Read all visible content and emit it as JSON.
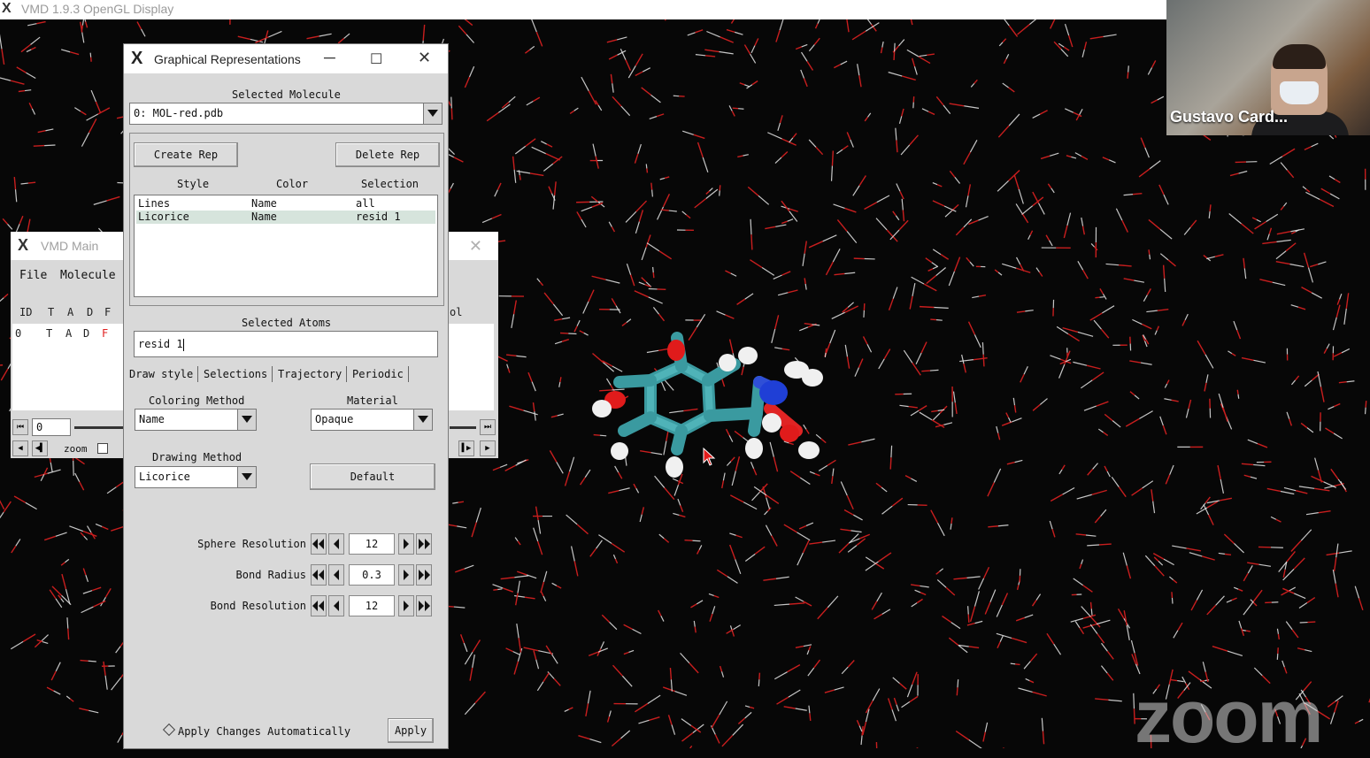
{
  "gl_window": {
    "title": "VMD 1.9.3 OpenGL Display"
  },
  "video": {
    "participant_name": "Gustavo Card..."
  },
  "watermark": {
    "text": "zoom"
  },
  "vmd_main": {
    "title": "VMD Main",
    "menu": [
      "File",
      "Molecule"
    ],
    "columns": [
      "ID",
      "T",
      "A",
      "D",
      "F"
    ],
    "rows": [
      {
        "id": "0",
        "t": "T",
        "a": "A",
        "d": "D",
        "f": "F"
      }
    ],
    "right_header": "ol",
    "frame_value": "0",
    "zoom_label": "zoom"
  },
  "graphical_representations": {
    "title": "Graphical Representations",
    "selected_molecule_label": "Selected Molecule",
    "selected_molecule": "0: MOL-red.pdb",
    "create_rep": "Create Rep",
    "delete_rep": "Delete Rep",
    "table_headers": {
      "style": "Style",
      "color": "Color",
      "selection": "Selection"
    },
    "reps": [
      {
        "style": "Lines",
        "color": "Name",
        "selection": "all"
      },
      {
        "style": "Licorice",
        "color": "Name",
        "selection": "resid 1"
      }
    ],
    "selected_atoms_label": "Selected Atoms",
    "selected_atoms": "resid 1",
    "tabs": [
      "Draw style",
      "Selections",
      "Trajectory",
      "Periodic"
    ],
    "coloring_method_label": "Coloring Method",
    "coloring_method": "Name",
    "material_label": "Material",
    "material": "Opaque",
    "drawing_method_label": "Drawing Method",
    "drawing_method": "Licorice",
    "default_button": "Default",
    "params": [
      {
        "label": "Sphere Resolution",
        "value": "12"
      },
      {
        "label": "Bond Radius",
        "value": "0.3"
      },
      {
        "label": "Bond Resolution",
        "value": "12"
      }
    ],
    "apply_auto_label": "Apply Changes Automatically",
    "apply_button": "Apply"
  },
  "colors": {
    "bond_red": "#c81e1e",
    "bond_white": "#e8e8e8",
    "carbon": "#3fa0a6",
    "nitrogen": "#1f3fd6",
    "oxygen": "#e01b1b",
    "hydrogen": "#f2f2f2"
  }
}
